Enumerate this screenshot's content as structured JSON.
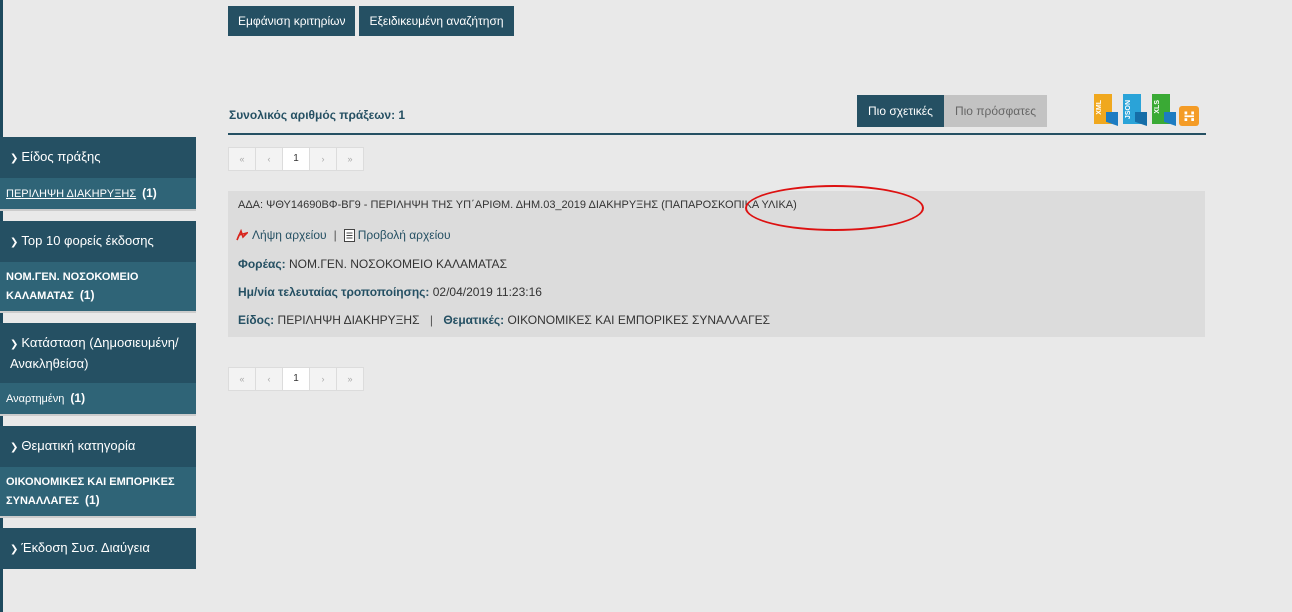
{
  "top_buttons": {
    "show_criteria": "Εμφάνιση κριτηρίων",
    "advanced_search": "Εξειδικευμένη αναζήτηση"
  },
  "sidebar": {
    "facets": [
      {
        "title": "Είδος πράξης",
        "item": "ΠΕΡΙΛΗΨΗ ΔΙΑΚΗΡΥΞΗΣ",
        "count": "(1)",
        "linked": true
      },
      {
        "title": "Top 10 φορείς έκδοσης",
        "item": "ΝΟΜ.ΓΕΝ. ΝΟΣΟΚΟΜΕΙΟ ΚΑΛΑΜΑΤΑΣ",
        "count": "(1)",
        "linked": false
      },
      {
        "title": "Κατάσταση (Δημοσιευμένη/ Ανακληθείσα)",
        "item": "Αναρτημένη",
        "count": "(1)",
        "linked": false
      },
      {
        "title": "Θεματική κατηγορία",
        "item": "ΟΙΚΟΝΟΜΙΚΕΣ ΚΑΙ ΕΜΠΟΡΙΚΕΣ ΣΥΝΑΛΛΑΓΕΣ",
        "count": "(1)",
        "linked": false
      },
      {
        "title": "Έκδοση Συσ. Διαύγεια"
      }
    ]
  },
  "results": {
    "total_label": "Συνολικός αριθμός πράξεων: 1",
    "sort_relevant": "Πιο σχετικές",
    "sort_recent": "Πιο πρόσφατες",
    "exports": [
      {
        "label": "XML",
        "icon": "xml-file-icon",
        "color": "#f0a81e"
      },
      {
        "label": "JSON",
        "icon": "json-file-icon",
        "color": "#2aa3d8"
      },
      {
        "label": "XLS",
        "icon": "xls-file-icon",
        "color": "#3aaa35"
      }
    ],
    "pager": {
      "first": "«",
      "prev": "‹",
      "page": "1",
      "next": "›",
      "last": "»"
    },
    "item": {
      "title_main": "ΑΔΑ: ΨΘΥ14690ΒΦ-ΒΓ9 - ΠΕΡΙΛΗΨΗ ΤΗΣ ΥΠ΄ΑΡΙΘΜ. ΔΗΜ.03_2019 ΔΙΑΚΗΡΥΞΗΣ ",
      "title_tail": "(ΠΑΠΑΡΟΣΚΟΠΙΚΑ ΥΛΙΚΑ)",
      "download": "Λήψη αρχείου",
      "view": "Προβολή αρχείου",
      "org_label": "Φορέας:",
      "org_value": "ΝΟΜ.ΓΕΝ. ΝΟΣΟΚΟΜΕΙΟ ΚΑΛΑΜΑΤΑΣ",
      "modified_label": "Ημ/νία τελευταίας τροποποίησης:",
      "modified_value": "02/04/2019 11:23:16",
      "type_label": "Είδος:",
      "type_value": "ΠΕΡΙΛΗΨΗ ΔΙΑΚΗΡΥΞΗΣ",
      "topics_label": "Θεματικές:",
      "topics_value": "ΟΙΚΟΝΟΜΙΚΕΣ ΚΑΙ ΕΜΠΟΡΙΚΕΣ ΣΥΝΑΛΛΑΓΕΣ"
    }
  },
  "colors": {
    "primary": "#255063",
    "facet_body": "#2f6477",
    "highlight": "#dd1111"
  }
}
